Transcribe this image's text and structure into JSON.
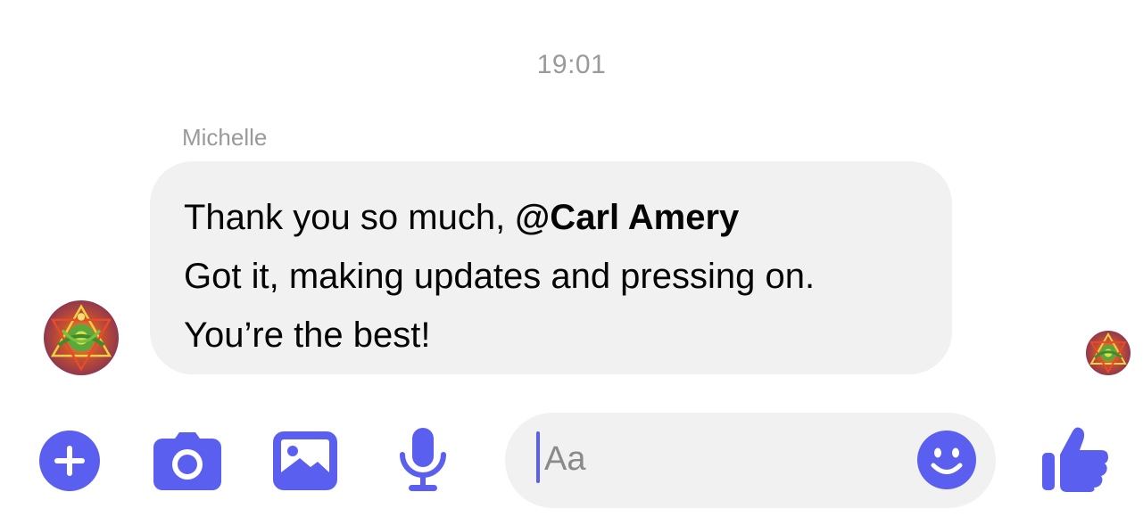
{
  "conversation": {
    "timestamp": "19:01",
    "messages": [
      {
        "sender": "Michelle",
        "line1_text": "Thank you so much, ",
        "mention": "@Carl Amery",
        "line2": "Got it, making updates and pressing on.",
        "line3": "You’re the best!"
      }
    ]
  },
  "composer": {
    "placeholder": "Aa",
    "value": ""
  },
  "toolbar": {
    "icons": [
      "plus-icon",
      "camera-icon",
      "photo-icon",
      "microphone-icon"
    ],
    "emoji_icon": "smiley-icon",
    "send_icon": "thumbs-up-icon"
  },
  "colors": {
    "accent": "#5b5ff0",
    "bubble_bg": "#f1f1f1",
    "meta_text": "#9a9a9a",
    "message_text": "#050505"
  }
}
